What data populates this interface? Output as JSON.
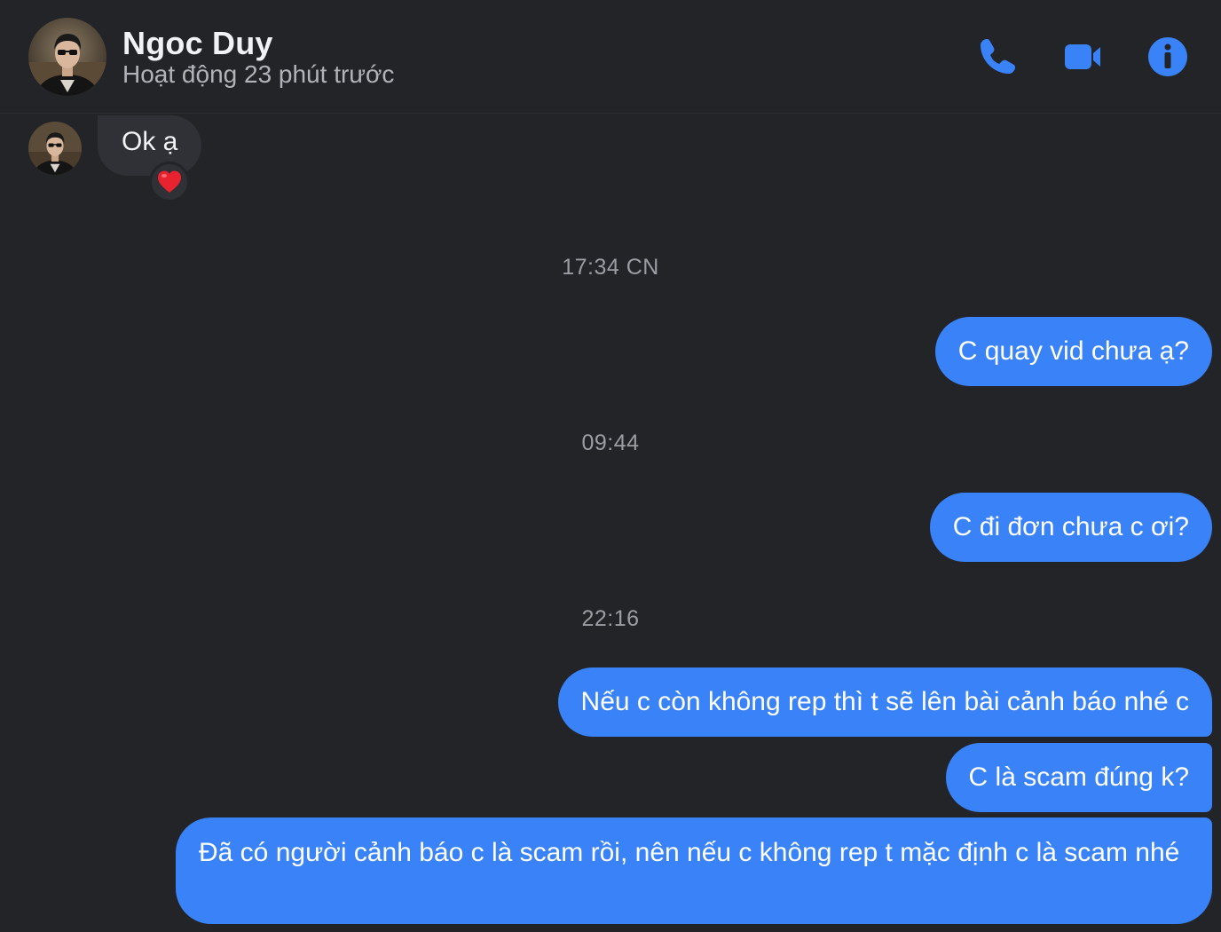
{
  "header": {
    "name": "Ngoc Duy",
    "status": "Hoạt động 23 phút trước",
    "accent_color": "#3a82f7",
    "icons": [
      "phone-icon",
      "video-camera-icon",
      "info-icon"
    ]
  },
  "messages": {
    "incoming": [
      {
        "text": "Ok ạ",
        "reaction": "heart"
      }
    ],
    "timestamps": [
      "17:34 CN",
      "09:44",
      "22:16"
    ],
    "outgoing": [
      "C quay vid chưa ạ?",
      "C đi đơn chưa c ơi?",
      "Nếu c còn không rep thì t sẽ lên bài cảnh báo nhé c",
      "C là scam đúng k?",
      "Đã có người cảnh báo c là scam rồi, nên nếu c không rep t mặc định c là scam nhé"
    ]
  }
}
